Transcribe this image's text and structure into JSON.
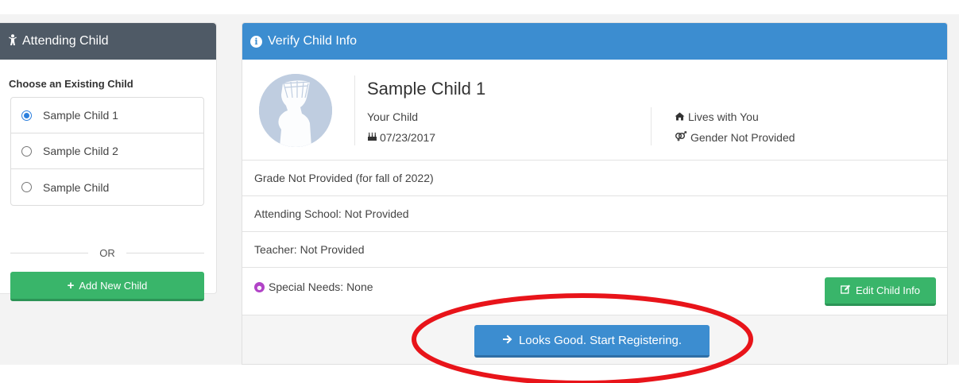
{
  "colors": {
    "left_header_bg": "#4f5a66",
    "right_header_bg": "#3c8dd0",
    "green_button": "#39b56a",
    "blue_button": "#3c8dd0",
    "annotation_red": "#e8141a",
    "special_needs_icon": "#b143c7"
  },
  "attending_child": {
    "title": "Attending Child",
    "icon": "child-icon",
    "choose_label": "Choose an Existing Child",
    "children": [
      {
        "label": "Sample Child 1",
        "selected": true
      },
      {
        "label": "Sample Child 2",
        "selected": false
      },
      {
        "label": "Sample Child",
        "selected": false
      }
    ],
    "or_text": "OR",
    "add_button_label": "Add New Child",
    "add_button_icon": "plus-icon"
  },
  "verify": {
    "title": "Verify Child Info",
    "icon": "info-circle-icon",
    "child_name": "Sample Child 1",
    "relation": "Your Child",
    "birth_date": "07/23/2017",
    "birth_date_icon": "birthday-cake-icon",
    "living": "Lives with You",
    "living_icon": "home-icon",
    "gender": "Gender Not Provided",
    "gender_icon": "gender-icon",
    "grade": "Grade Not Provided (for fall of 2022)",
    "school_label": "Attending School:",
    "school_value": "Not Provided",
    "teacher_label": "Teacher:",
    "teacher_value": "Not Provided",
    "special_needs_label": "Special Needs:",
    "special_needs_value": "None",
    "special_needs_icon": "special-needs-icon",
    "edit_button_label": "Edit Child Info",
    "edit_button_icon": "edit-icon",
    "start_button_label": "Looks Good. Start Registering.",
    "start_button_icon": "arrow-right-icon"
  }
}
